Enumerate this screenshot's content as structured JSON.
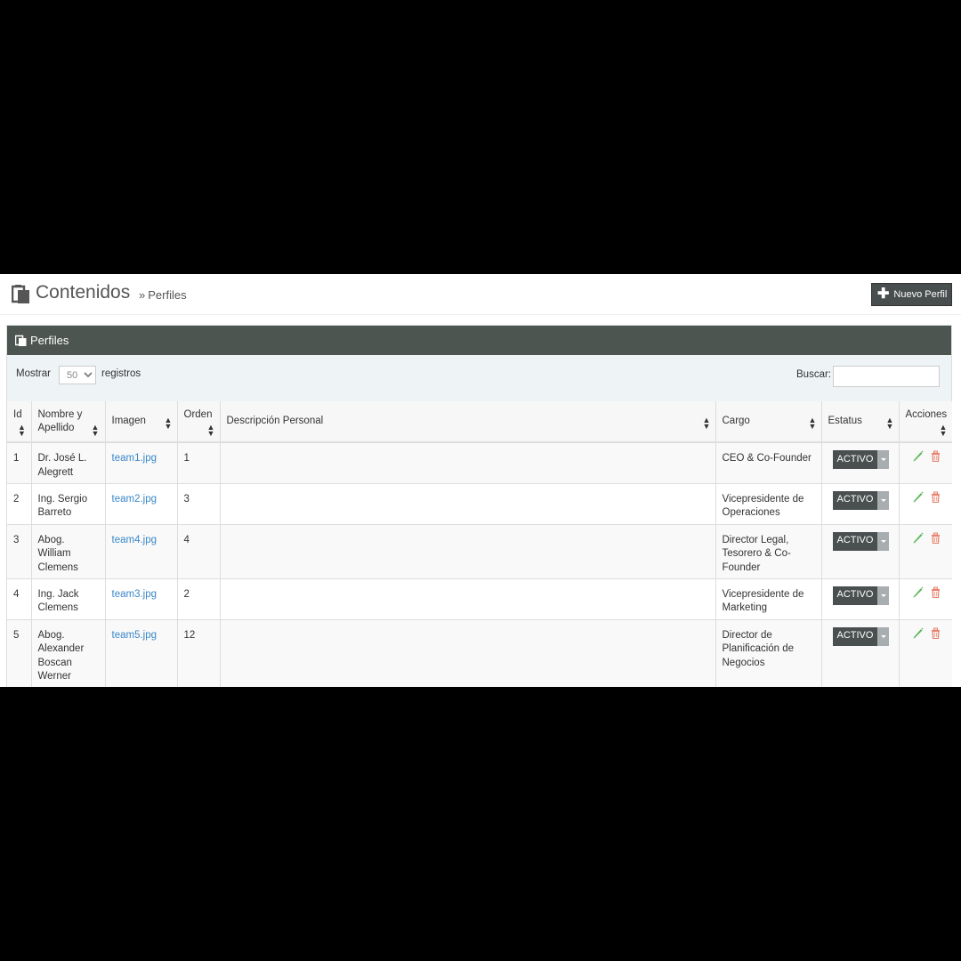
{
  "header": {
    "title": "Contenidos",
    "breadcrumb_sep": "»",
    "breadcrumb": "Perfiles",
    "new_button": "Nuevo Perfil"
  },
  "panel": {
    "title": "Perfiles"
  },
  "filters": {
    "show_label": "Mostrar",
    "page_size": "50",
    "records_label": "registros",
    "search_label": "Buscar:",
    "search_value": ""
  },
  "table": {
    "columns": {
      "id": "Id",
      "name": "Nombre y Apellido",
      "image": "Imagen",
      "order": "Orden",
      "description": "Descripción Personal",
      "position": "Cargo",
      "status": "Estatus",
      "actions": "Acciones"
    },
    "rows": [
      {
        "id": "1",
        "name": "Dr. José L. Alegrett",
        "image": "team1.jpg",
        "order": "1",
        "description": "",
        "position": "CEO & Co-Founder",
        "status": "ACTIVO"
      },
      {
        "id": "2",
        "name": "Ing. Sergio Barreto",
        "image": "team2.jpg",
        "order": "3",
        "description": "",
        "position": "Vicepresidente de Operaciones",
        "status": "ACTIVO"
      },
      {
        "id": "3",
        "name": "Abog. William Clemens",
        "image": "team4.jpg",
        "order": "4",
        "description": "",
        "position": "Director Legal, Tesorero & Co-Founder",
        "status": "ACTIVO"
      },
      {
        "id": "4",
        "name": "Ing. Jack Clemens",
        "image": "team3.jpg",
        "order": "2",
        "description": "",
        "position": "Vicepresidente de Marketing",
        "status": "ACTIVO"
      },
      {
        "id": "5",
        "name": "Abog. Alexander Boscan Werner",
        "image": "team5.jpg",
        "order": "12",
        "description": "",
        "position": "Director de Planificación de Negocios",
        "status": "ACTIVO"
      }
    ]
  },
  "icons": {
    "page": "documents-icon",
    "edit": "pencil-icon",
    "delete": "trash-icon"
  },
  "colors": {
    "panel_heading": "#4d5550",
    "link": "#3a87c8",
    "edit": "#5cb85c",
    "delete": "#e8836f"
  }
}
